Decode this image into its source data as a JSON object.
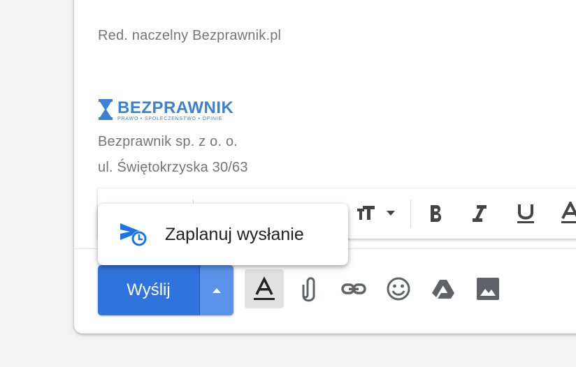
{
  "signature": {
    "editor_line": "Red. naczelny Bezprawnik.pl",
    "logo_name": "BEZPRAWNIK",
    "logo_tagline": "PRAWO  •  SPOŁECZEŃSTWO  •  OPINIE",
    "company": "Bezprawnik sp. z o. o.",
    "address": "ul. Świętokrzyska 30/63"
  },
  "schedule_menu": {
    "label": "Zaplanuj wysłanie"
  },
  "send": {
    "label": "Wyślij"
  },
  "colors": {
    "send_blue": "#2f73dd",
    "logo_blue": "#3b82d6",
    "icon_grey": "#5f6368"
  },
  "formatting_bar": [
    "text-size-icon",
    "bold-icon",
    "italic-icon",
    "underline-icon",
    "text-color-icon"
  ],
  "toolbar_icons": [
    "formatting-options-icon",
    "attach-icon",
    "link-icon",
    "emoji-icon",
    "drive-icon",
    "image-icon"
  ]
}
